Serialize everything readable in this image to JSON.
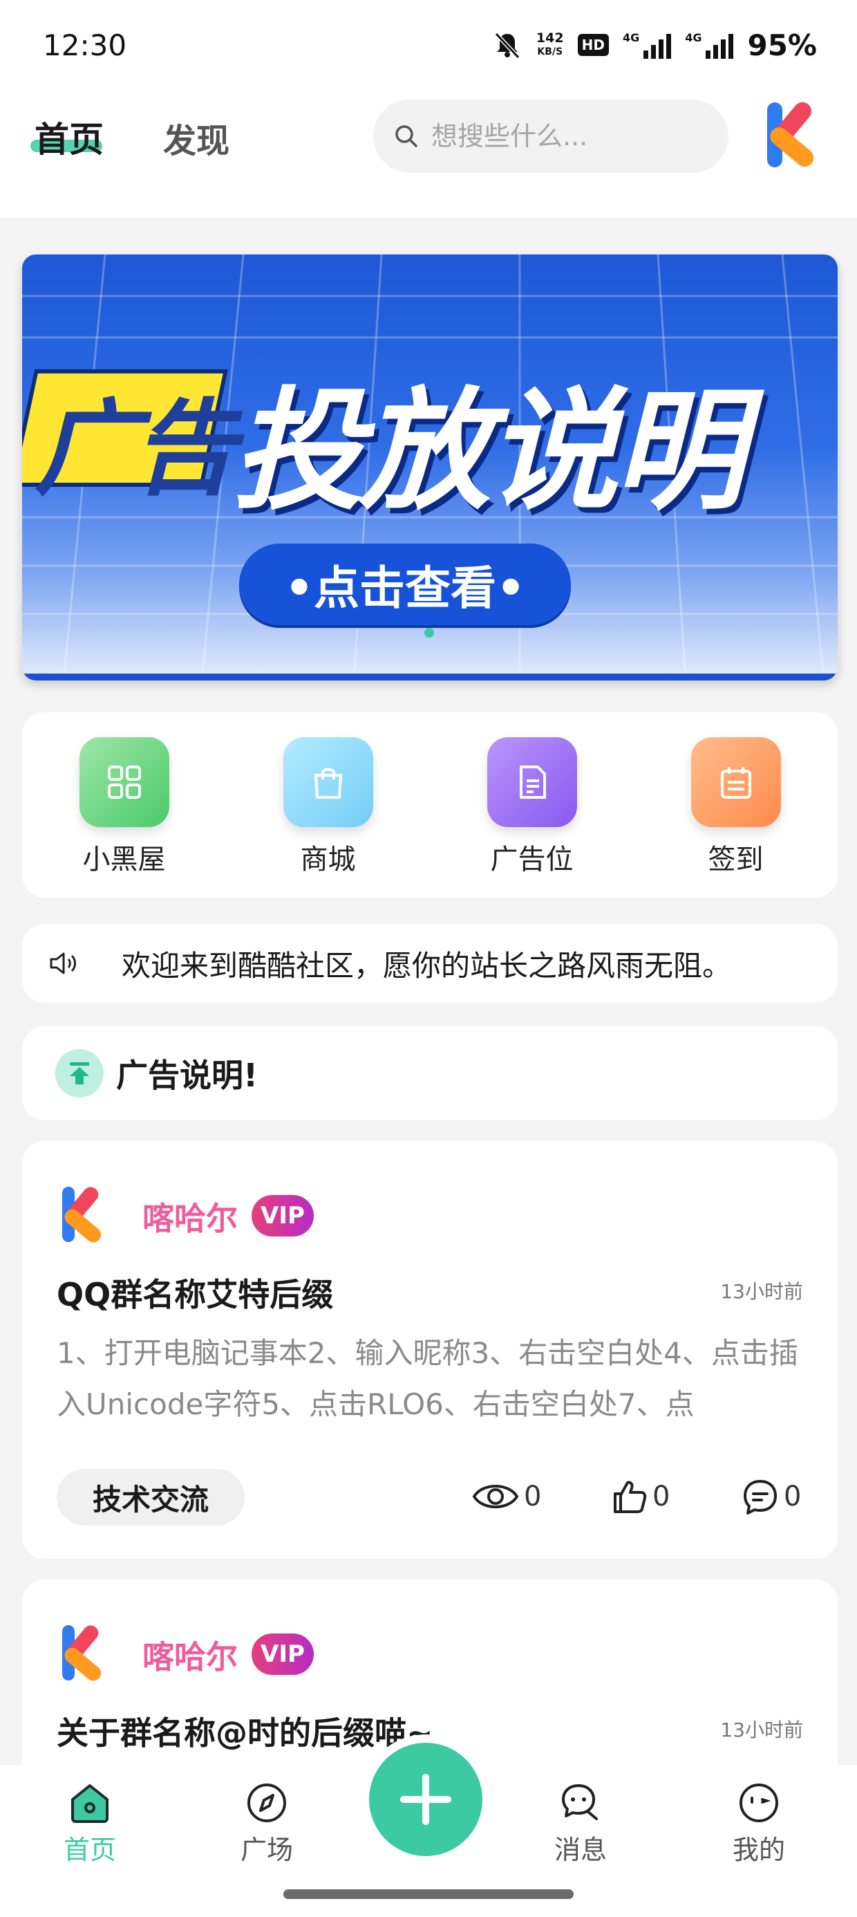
{
  "status": {
    "time": "12:30",
    "net_speed": "142",
    "net_unit": "KB/S",
    "hd": "HD",
    "sim1": "4G",
    "sim2": "4G",
    "battery": "95%"
  },
  "header": {
    "tabs": {
      "home": "首页",
      "discover": "发现"
    },
    "search_placeholder": "想搜些什么..."
  },
  "banner": {
    "yellow_text": "广告",
    "title": "投放说明",
    "button": "•点击查看•"
  },
  "menu": [
    {
      "label": "小黑屋",
      "icon": "grid-icon",
      "color": "#5ed37a"
    },
    {
      "label": "商城",
      "icon": "shopping-bag-icon",
      "color": "#7fd5fb"
    },
    {
      "label": "广告位",
      "icon": "document-icon",
      "color": "#9b6cf5"
    },
    {
      "label": "签到",
      "icon": "calendar-icon",
      "color": "#ff9a5e"
    }
  ],
  "notice": {
    "text": "欢迎来到酷酷社区，愿你的站长之路风雨无阻。"
  },
  "ad_note": {
    "text": "广告说明!"
  },
  "posts": [
    {
      "author": "喀哈尔",
      "badge": "VIP",
      "title": "QQ群名称艾特后缀",
      "time": "13小时前",
      "body": "1、打开电脑记事本2、输入昵称3、右击空白处4、点击插入Unicode字符5、点击RLO6、右击空白处7、点",
      "tag": "技术交流",
      "views": "0",
      "likes": "0",
      "comments": "0"
    },
    {
      "author": "喀哈尔",
      "badge": "VIP",
      "title": "关于群名称@时的后缀喵~",
      "time": "13小时前"
    }
  ],
  "tabbar": {
    "home": "首页",
    "plaza": "广场",
    "messages": "消息",
    "mine": "我的"
  },
  "colors": {
    "accent": "#3ccaa2",
    "author": "#ef5c9b"
  }
}
